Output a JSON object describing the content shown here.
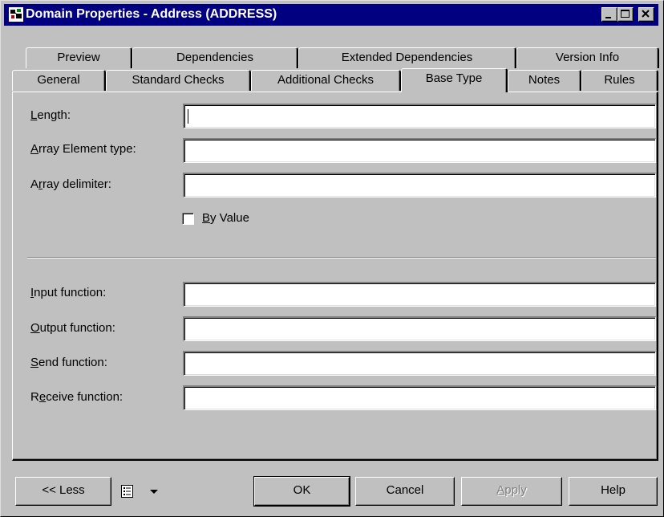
{
  "window": {
    "title": "Domain Properties - Address (ADDRESS)"
  },
  "tabs": {
    "row_back": [
      {
        "label": "Preview"
      },
      {
        "label": "Dependencies"
      },
      {
        "label": "Extended Dependencies"
      },
      {
        "label": "Version Info"
      }
    ],
    "row_front": [
      {
        "label": "General"
      },
      {
        "label": "Standard Checks"
      },
      {
        "label": "Additional Checks"
      },
      {
        "label": "Base Type",
        "active": true
      },
      {
        "label": "Notes"
      },
      {
        "label": "Rules"
      }
    ]
  },
  "form": {
    "length": {
      "label_key": "L",
      "label_rest": "ength:",
      "value": ""
    },
    "array_element_type": {
      "label_key": "A",
      "label_rest": "rray Element type:",
      "value": ""
    },
    "array_delimiter": {
      "label_pre": "A",
      "label_key": "r",
      "label_rest": "ray delimiter:",
      "value": ""
    },
    "by_value": {
      "label_key": "B",
      "label_rest": "y Value",
      "checked": false
    },
    "input_function": {
      "label_key": "I",
      "label_rest": "nput function:",
      "value": ""
    },
    "output_function": {
      "label_key": "O",
      "label_rest": "utput function:",
      "value": ""
    },
    "send_function": {
      "label_key": "S",
      "label_rest": "end function:",
      "value": ""
    },
    "receive_function": {
      "label_pre": "R",
      "label_key": "e",
      "label_rest": "ceive function:",
      "value": ""
    }
  },
  "buttons": {
    "less": "<< Less",
    "ok": "OK",
    "cancel": "Cancel",
    "apply_key": "A",
    "apply_rest": "pply",
    "help": "Help"
  },
  "icons": {
    "app": "domain-properties-icon",
    "view": "list-view-icon",
    "dropdown": "triangle-down-icon"
  },
  "colors": {
    "titlebar": "#000080",
    "face": "#c0c0c0",
    "disabled_text": "#808080"
  }
}
